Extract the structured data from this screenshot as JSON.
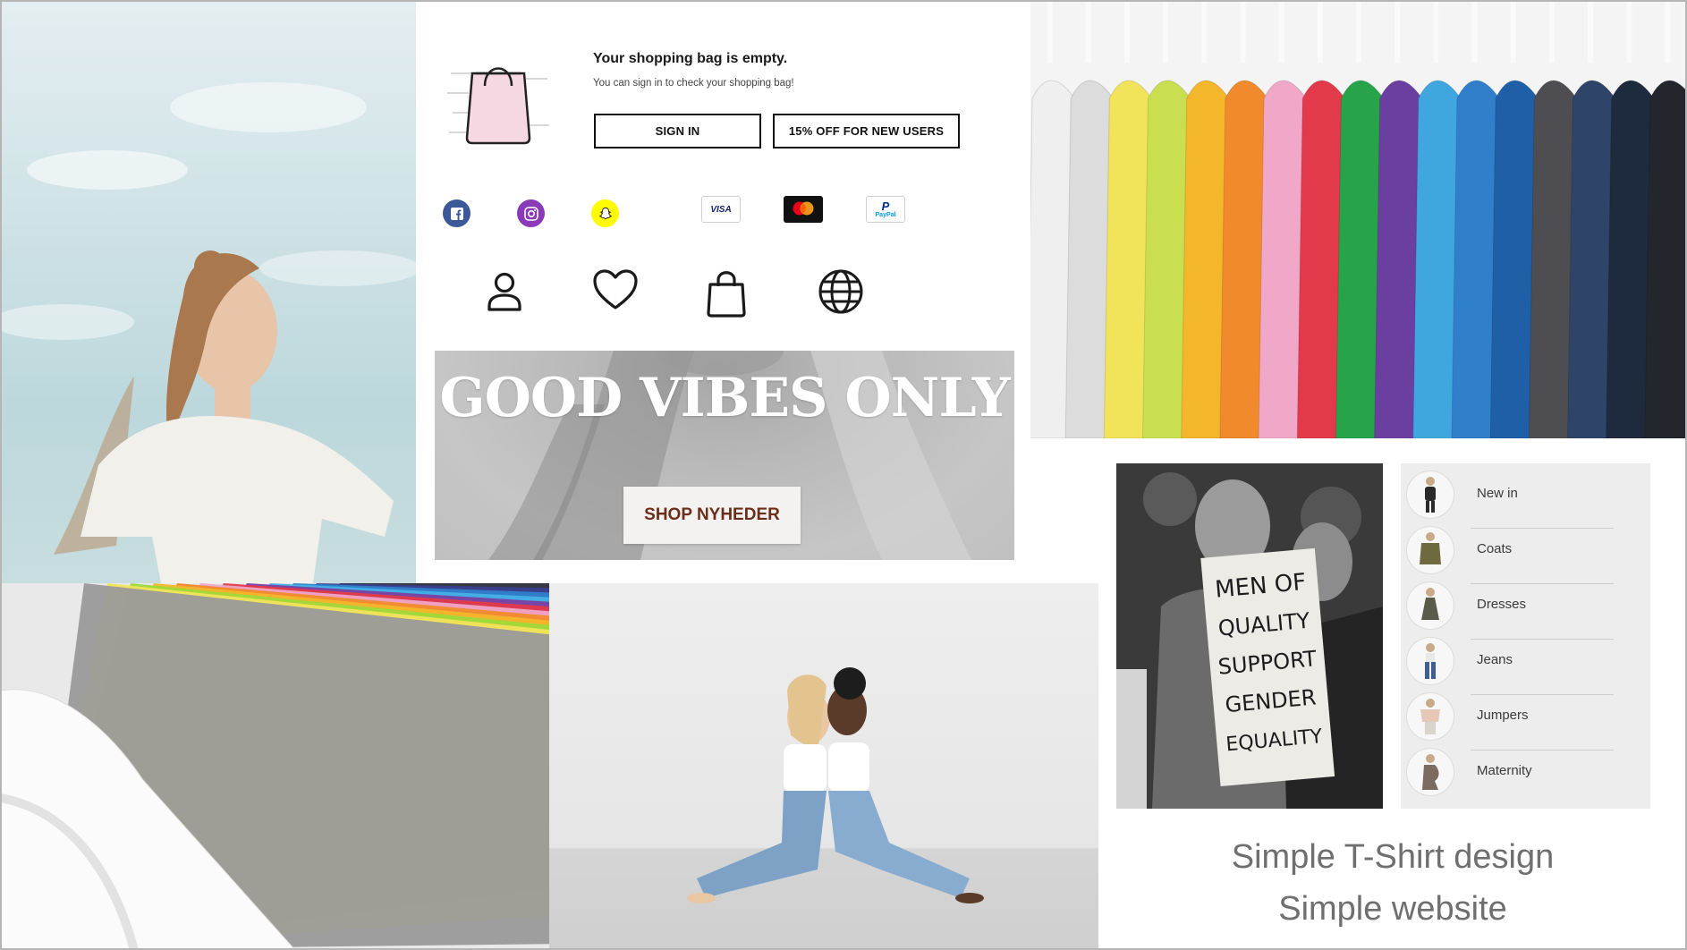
{
  "shopping_bag": {
    "title": "Your shopping bag is empty.",
    "subtitle": "You can sign in to check your shopping bag!",
    "sign_in_label": "SIGN IN",
    "new_users_label": "15% OFF FOR NEW USERS"
  },
  "social_icons": [
    "facebook-icon",
    "instagram-icon",
    "snapchat-icon"
  ],
  "payment_icons": [
    {
      "name": "visa-icon",
      "label": "VISA"
    },
    {
      "name": "mastercard-icon"
    },
    {
      "name": "paypal-icon",
      "label": "PayPal"
    }
  ],
  "nav_icons": [
    "account-icon",
    "wishlist-icon",
    "bag-icon",
    "globe-icon"
  ],
  "banner": {
    "title": "GOOD VIBES ONLY",
    "button_label": "SHOP NYHEDER",
    "button_text_color": "#6b2e1a"
  },
  "protest_sign": [
    "MEN OF",
    "QUALITY",
    "SUPPORT",
    "GENDER",
    "EQUALITY"
  ],
  "categories": [
    {
      "label": "New in"
    },
    {
      "label": "Coats"
    },
    {
      "label": "Dresses"
    },
    {
      "label": "Jeans"
    },
    {
      "label": "Jumpers"
    },
    {
      "label": "Maternity"
    }
  ],
  "caption": {
    "line1": "Simple T-Shirt design",
    "line2": "Simple website"
  },
  "colors": {
    "facebook": "#3b5998",
    "instagram": "#8a3ab9",
    "snapchat": "#fffc00",
    "bag_pink": "#f6d8e2"
  }
}
